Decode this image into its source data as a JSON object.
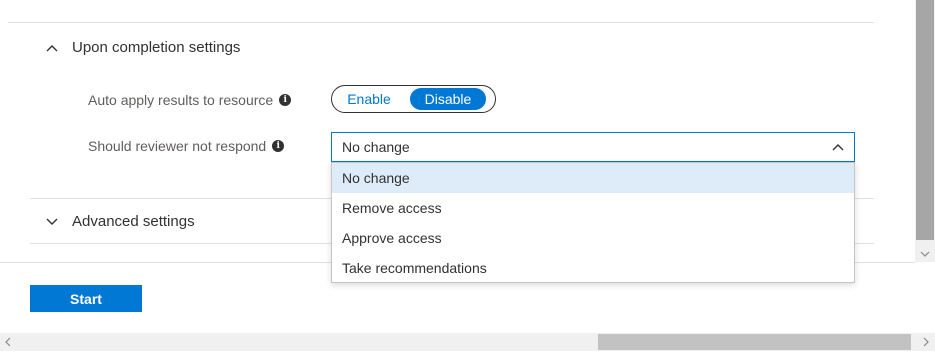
{
  "completion_section": {
    "title": "Upon completion settings",
    "expanded": true,
    "chevron_icon": "chevron-up-icon"
  },
  "auto_apply": {
    "label": "Auto apply results to resource",
    "options": [
      "Enable",
      "Disable"
    ],
    "selected": "Disable"
  },
  "reviewer": {
    "label": "Should reviewer not respond",
    "selected": "No change",
    "open": true,
    "options": [
      "No change",
      "Remove access",
      "Approve access",
      "Take recommendations"
    ]
  },
  "advanced_section": {
    "title": "Advanced settings",
    "expanded": false,
    "chevron_icon": "chevron-down-icon"
  },
  "start_label": "Start",
  "colors": {
    "accent": "#0078d4",
    "selected_bg": "#deecf9",
    "text": "#323130",
    "muted_text": "#605e5c"
  }
}
